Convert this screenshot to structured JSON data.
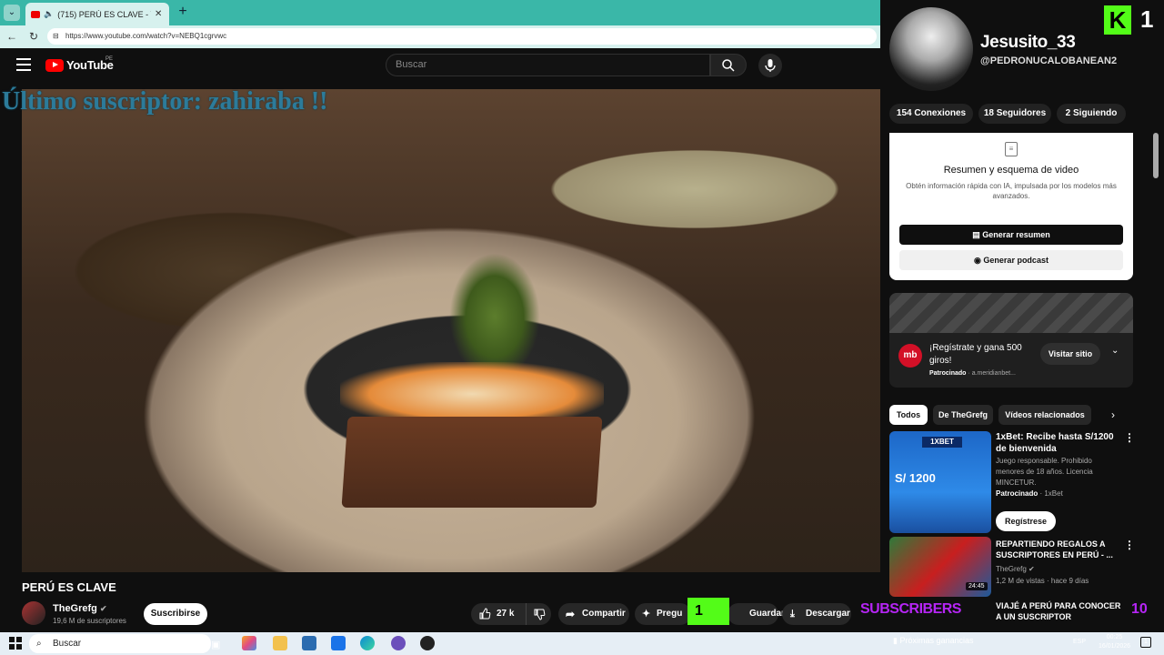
{
  "browser": {
    "tab_title": "(715) PERÚ ES CLAVE - YouTub",
    "url": "https://www.youtube.com/watch?v=NEBQ1cgrvwc"
  },
  "youtube": {
    "logo_text": "YouTube",
    "country_code": "PE",
    "search_placeholder": "Buscar"
  },
  "video": {
    "overlay_text": "Último suscriptor: zahiraba !!",
    "title": "PERÚ ES CLAVE",
    "channel_name": "TheGrefg",
    "channel_subs": "19,6 M de suscriptores",
    "subscribe_label": "Suscribirse",
    "likes": "27 k",
    "share_label": "Compartir",
    "ask_label": "Pregu",
    "save_label": "Guardar",
    "download_label": "Descargar",
    "kick_counter": "1"
  },
  "profile": {
    "name": "Jesusito_33",
    "handle": "@PEDRONUCALOBANEAN2",
    "kick_count": "1",
    "stats": {
      "connections": "154 Conexiones",
      "followers": "18 Seguidores",
      "following": "2 Siguiendo"
    }
  },
  "summary": {
    "title": "Resumen y esquema de video",
    "description": "Obtén información rápida con IA, impulsada por los modelos más avanzados.",
    "generate_summary": "Generar resumen",
    "generate_podcast": "Generar podcast"
  },
  "ad": {
    "logo": "mb",
    "title": "¡Regístrate y gana 500 giros!",
    "sponsored": "Patrocinado",
    "domain": "a.meridianbet...",
    "visit_label": "Visitar sitio"
  },
  "chips": [
    "Todos",
    "De TheGrefg",
    "Vídeos relacionados"
  ],
  "recommendations": [
    {
      "title": "1xBet: Recibe hasta S/1200 de bienvenida",
      "description": "Juego responsable. Prohibido menores de 18 años. Licencia MINCETUR.",
      "sponsored": "Patrocinado",
      "advertiser": "1xBet",
      "cta": "Regístrese",
      "thumb_badge": "1XBET",
      "thumb_amount": "S/ 1200"
    },
    {
      "title": "REPARTIENDO REGALOS A SUSCRIPTORES EN PERÚ - ...",
      "channel": "TheGrefg",
      "meta": "1,2 M de vistas · hace 9 días",
      "duration": "24:45"
    },
    {
      "title": "VIAJÉ A PERÚ PARA CONOCER A UN SUSCRIPTOR"
    }
  ],
  "overlay_bottom": {
    "subscribers_label": "SUBSCRIBERS",
    "subscribers_count": "10"
  },
  "taskbar": {
    "search_label": "Buscar",
    "weather": "Próximas ganancias",
    "lang": "ESP",
    "time": "00:25",
    "date": "16/01/2026"
  }
}
